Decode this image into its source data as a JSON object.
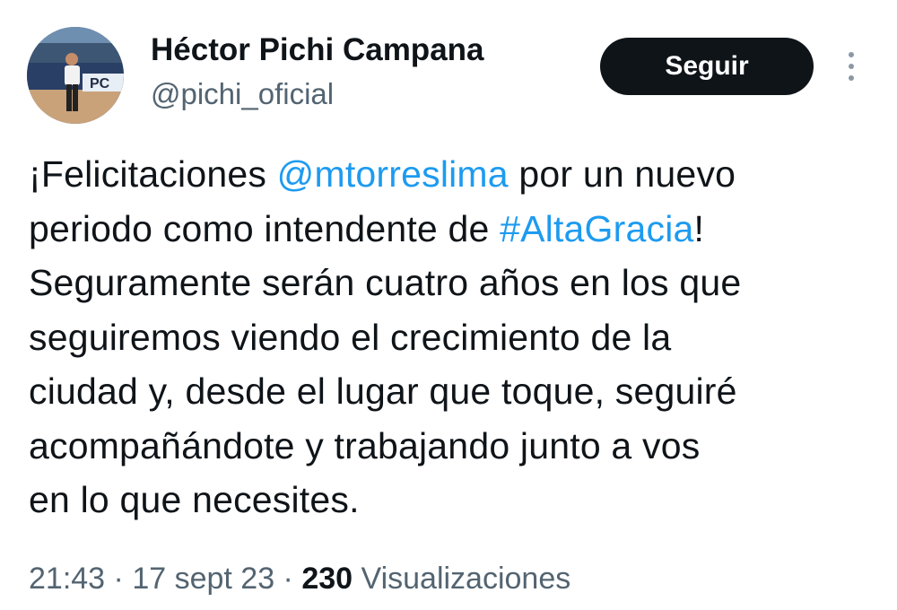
{
  "user": {
    "display_name": "Héctor Pichi Campana",
    "handle": "@pichi_oficial"
  },
  "follow_button": {
    "label": "Seguir"
  },
  "more_menu": {
    "icon": "more-vertical-icon"
  },
  "tweet": {
    "lines": [
      [
        {
          "text": "¡Felicitaciones "
        },
        {
          "text": "@mtorreslima",
          "type": "mention"
        },
        {
          "text": " por un nuevo"
        }
      ],
      [
        {
          "text": "periodo como intendente de "
        },
        {
          "text": "#AltaGracia",
          "type": "hashtag"
        },
        {
          "text": "!"
        }
      ],
      [
        {
          "text": "Seguramente serán cuatro años en los que"
        }
      ],
      [
        {
          "text": "seguiremos viendo el crecimiento de la"
        }
      ],
      [
        {
          "text": "ciudad y, desde el lugar que toque, seguiré"
        }
      ],
      [
        {
          "text": "acompañándote y trabajando junto a vos"
        }
      ],
      [
        {
          "text": "en lo que necesites."
        }
      ]
    ]
  },
  "meta": {
    "time": "21:43",
    "separator": " · ",
    "date": "17 sept 23",
    "views_count": "230",
    "views_label": " Visualizaciones"
  },
  "colors": {
    "link": "#1d9bf0",
    "text": "#0f1419",
    "secondary": "#536471",
    "button_bg": "#0f1419"
  }
}
